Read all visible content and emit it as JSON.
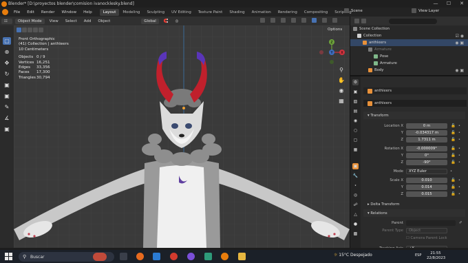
{
  "window": {
    "title": "Blender* [D:\\proyectos blender\\comision ivanocklesky.blend]",
    "controls": [
      "—",
      "☐",
      "✕"
    ]
  },
  "menu": [
    "File",
    "Edit",
    "Render",
    "Window",
    "Help"
  ],
  "workspaces": [
    "Layout",
    "Modeling",
    "Sculpting",
    "UV Editing",
    "Texture Paint",
    "Shading",
    "Animation",
    "Rendering",
    "Compositing",
    "Scripting"
  ],
  "active_workspace": "Layout",
  "scene_label": "Scene",
  "view_layer_label": "View Layer",
  "viewport_header": {
    "mode": "Object Mode",
    "menus": [
      "View",
      "Select",
      "Add",
      "Object"
    ],
    "orientation": "Global"
  },
  "viewport_overlay": {
    "view_name": "Front Orthographic",
    "collection": "(41) Collection | anthleers",
    "scale": "10 Centimeters",
    "stats": [
      {
        "k": "Objects",
        "v": "0 / 9"
      },
      {
        "k": "Vertices",
        "v": "16,251"
      },
      {
        "k": "Edges",
        "v": "33,356"
      },
      {
        "k": "Faces",
        "v": "17,300"
      },
      {
        "k": "Triangles",
        "v": "30,794"
      }
    ]
  },
  "options_label": "Options",
  "gizmo": {
    "x": "X",
    "y": "Y",
    "z": "Z"
  },
  "outliner": {
    "rows": [
      {
        "label": "Scene Collection",
        "color": "#888888"
      },
      {
        "label": "Collection",
        "color": "#d0d0d0"
      },
      {
        "label": "anthleers",
        "color": "#e8913a"
      },
      {
        "label": "Armature",
        "color": "#7a7a7a"
      },
      {
        "label": "Pose",
        "color": "#7fb88a"
      },
      {
        "label": "Armature",
        "color": "#7fb88a"
      },
      {
        "label": "Body",
        "color": "#e8913a"
      }
    ]
  },
  "properties": {
    "object_name": "anthleers",
    "data_name": "anthleers",
    "transform_label": "Transform",
    "location": {
      "label_x": "Location X",
      "x": "0 m",
      "y": "-0.034317 m",
      "z": "1.7311 m"
    },
    "rotation": {
      "label_x": "Rotation X",
      "x": "-0.000009°",
      "y": "0°",
      "z": "-90°"
    },
    "mode": {
      "label": "Mode",
      "value": "XYZ Euler"
    },
    "scale": {
      "label_x": "Scale X",
      "x": "0.010",
      "y": "0.014",
      "z": "0.015"
    },
    "axis_y": "Y",
    "axis_z": "Z",
    "delta_transform": "Delta Transform",
    "relations": "Relations",
    "parent_label": "Parent",
    "parent_type_label": "Parent Type",
    "parent_type_value": "Object",
    "camera_parent_lock": "Camera Parent Lock",
    "tracking_axis_label": "Tracking Axis",
    "tracking_axis_value": "+Y"
  },
  "taskbar": {
    "search_placeholder": "Buscar",
    "weather": "15°C  Despejado",
    "language": "ESP",
    "time": "21:55",
    "date": "22/8/2023"
  },
  "colors": {
    "accent": "#4772b3",
    "blender_orange": "#e87d0d",
    "active_tab": "#3d3d3d"
  }
}
